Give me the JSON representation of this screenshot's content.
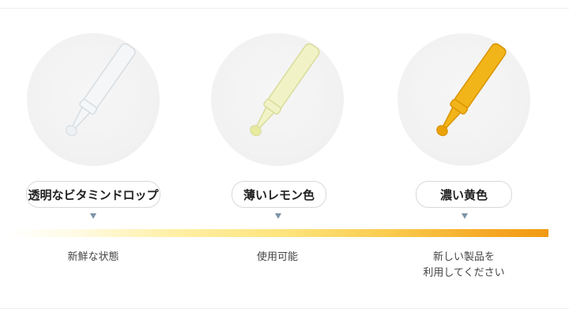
{
  "stages": [
    {
      "label": "透明なビタミンドロップ",
      "caption_lines": [
        "新鮮な状態"
      ],
      "dropper_fill": "#f4f6f8",
      "dropper_stroke": "#d8dde2",
      "drop_fill": "#eef1f4"
    },
    {
      "label": "薄いレモン色",
      "caption_lines": [
        "使用可能"
      ],
      "dropper_fill": "#f1f3c6",
      "dropper_stroke": "#d8dc9a",
      "drop_fill": "#e8eb9e"
    },
    {
      "label": "濃い黄色",
      "caption_lines": [
        "新しい製品を",
        "利用してください"
      ],
      "dropper_fill": "#f2b519",
      "dropper_stroke": "#d99400",
      "drop_fill": "#e9a107"
    }
  ],
  "colors": {
    "marker": "#7c93a8",
    "gradient_start": "#ffffff",
    "gradient_end": "#f19a12"
  }
}
